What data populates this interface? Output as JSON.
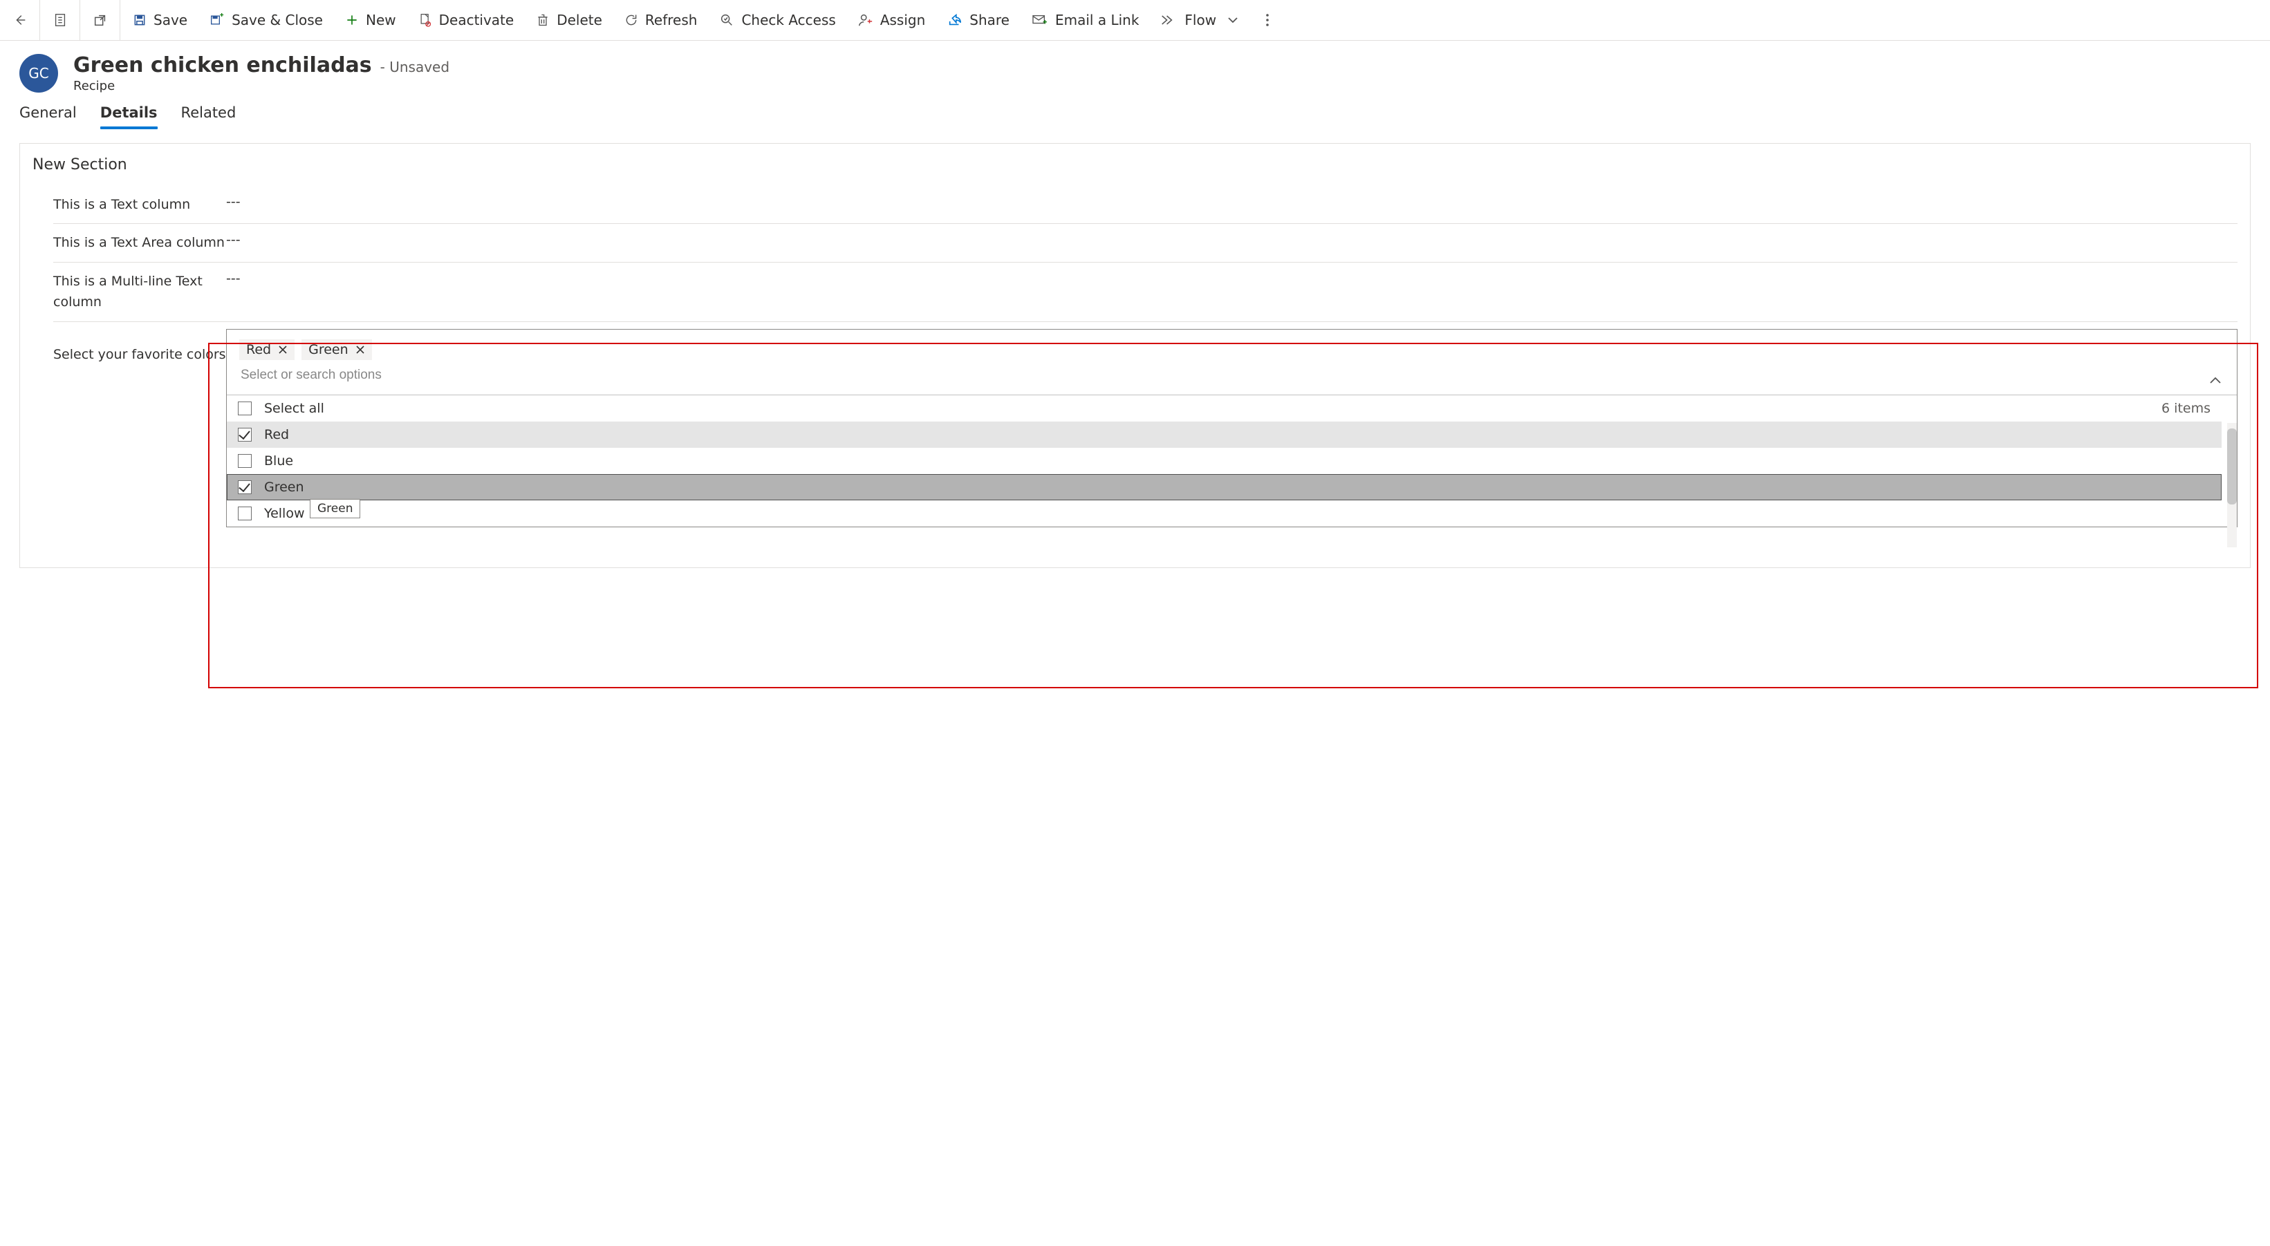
{
  "toolbar": {
    "save": "Save",
    "save_close": "Save & Close",
    "new": "New",
    "deactivate": "Deactivate",
    "delete": "Delete",
    "refresh": "Refresh",
    "check_access": "Check Access",
    "assign": "Assign",
    "share": "Share",
    "email_link": "Email a Link",
    "flow": "Flow"
  },
  "record": {
    "avatar_initials": "GC",
    "title": "Green chicken enchiladas",
    "state": "- Unsaved",
    "entity": "Recipe"
  },
  "tabs": {
    "general": "General",
    "details": "Details",
    "related": "Related"
  },
  "section": {
    "title": "New Section",
    "fields": {
      "text_col": {
        "label": "This is a Text column",
        "value": "---"
      },
      "textarea_col": {
        "label": "This is a Text Area column",
        "value": "---"
      },
      "multiline_col": {
        "label": "This is a Multi-line Text column",
        "value": "---"
      },
      "multiselect": {
        "label": "Select your favorite colors",
        "placeholder": "Select or search options",
        "selected_pills": [
          "Red",
          "Green"
        ],
        "count_text": "6 items",
        "select_all": "Select all",
        "options": [
          {
            "label": "Red",
            "checked": true,
            "state": "selected"
          },
          {
            "label": "Blue",
            "checked": false,
            "state": ""
          },
          {
            "label": "Green",
            "checked": true,
            "state": "active"
          },
          {
            "label": "Yellow",
            "checked": false,
            "state": ""
          }
        ],
        "tooltip": "Green"
      }
    }
  }
}
